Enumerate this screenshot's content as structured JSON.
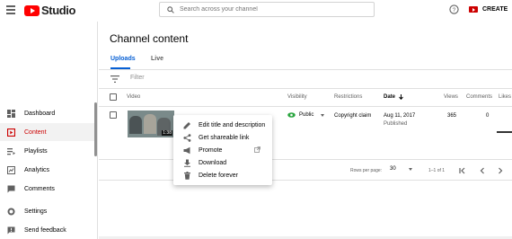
{
  "header": {
    "logo_text": "Studio",
    "search_placeholder": "Search across your channel",
    "create_label": "CREATE"
  },
  "sidebar": {
    "items": [
      {
        "label": "Dashboard",
        "icon": "dashboard-icon"
      },
      {
        "label": "Content",
        "icon": "content-icon",
        "active": true
      },
      {
        "label": "Playlists",
        "icon": "playlists-icon"
      },
      {
        "label": "Analytics",
        "icon": "analytics-icon"
      },
      {
        "label": "Comments",
        "icon": "comments-icon"
      },
      {
        "label": "Settings",
        "icon": "settings-icon"
      },
      {
        "label": "Send feedback",
        "icon": "feedback-icon"
      }
    ]
  },
  "main": {
    "title": "Channel content",
    "tabs": [
      {
        "label": "Uploads",
        "selected": true
      },
      {
        "label": "Live",
        "selected": false
      }
    ],
    "filter_placeholder": "Filter",
    "columns": {
      "video": "Video",
      "visibility": "Visibility",
      "restrictions": "Restrictions",
      "date": "Date",
      "views": "Views",
      "comments": "Comments",
      "likes": "Likes"
    },
    "row": {
      "duration": "1:38",
      "visibility": "Public",
      "restriction": "Copyright claim",
      "date": "Aug 11, 2017",
      "date_status": "Published",
      "views": "365",
      "comments": "0"
    },
    "pager": {
      "rows_per_page_label": "Rows per page:",
      "rows_per_page": "30",
      "range": "1–1 of 1"
    }
  },
  "context_menu": {
    "items": [
      {
        "label": "Edit title and description",
        "icon": "pencil-icon"
      },
      {
        "label": "Get shareable link",
        "icon": "share-icon"
      },
      {
        "label": "Promote",
        "icon": "megaphone-icon"
      },
      {
        "label": "Download",
        "icon": "download-icon"
      },
      {
        "label": "Delete forever",
        "icon": "trash-icon"
      }
    ]
  },
  "colors": {
    "brand_red": "#ff0000",
    "active_red": "#cc0000",
    "link_blue": "#065fd4",
    "public_green": "#2ba640"
  }
}
